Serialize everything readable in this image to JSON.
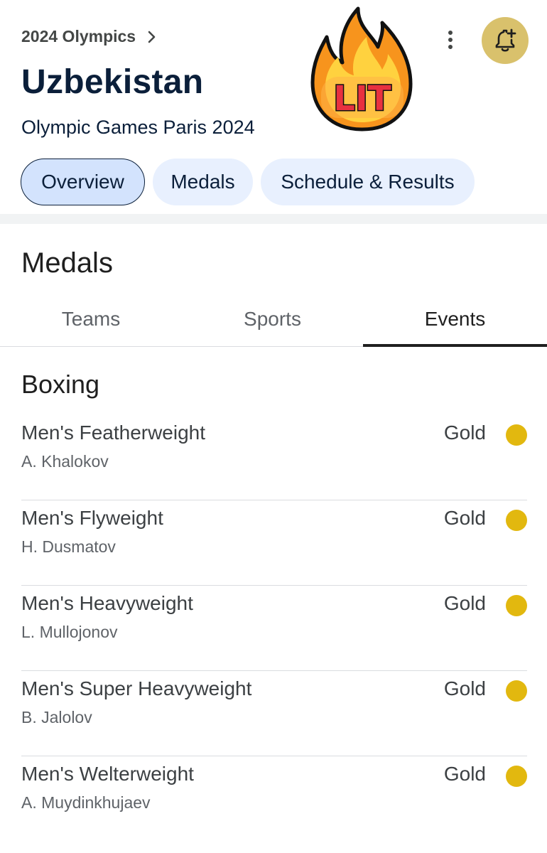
{
  "header": {
    "breadcrumb": "2024 Olympics",
    "title": "Uzbekistan",
    "subtitle": "Olympic Games Paris 2024",
    "sticker_text": "LIT"
  },
  "icons": {
    "breadcrumb": "chevron-right-icon",
    "menu": "more-vert-icon",
    "notify": "bell-plus-icon",
    "sticker": "fire-icon"
  },
  "chips": [
    {
      "label": "Overview",
      "selected": true
    },
    {
      "label": "Medals",
      "selected": false
    },
    {
      "label": "Schedule & Results",
      "selected": false
    }
  ],
  "medals": {
    "title": "Medals",
    "tabs": [
      {
        "label": "Teams",
        "selected": false
      },
      {
        "label": "Sports",
        "selected": false
      },
      {
        "label": "Events",
        "selected": true
      }
    ],
    "sport": "Boxing",
    "events": [
      {
        "name": "Men's Featherweight",
        "athlete": "A. Khalokov",
        "medal": "Gold"
      },
      {
        "name": "Men's Flyweight",
        "athlete": "H. Dusmatov",
        "medal": "Gold"
      },
      {
        "name": "Men's Heavyweight",
        "athlete": "L. Mullojonov",
        "medal": "Gold"
      },
      {
        "name": "Men's Super Heavyweight",
        "athlete": "B. Jalolov",
        "medal": "Gold"
      },
      {
        "name": "Men's Welterweight",
        "athlete": "A. Muydinkhujaev",
        "medal": "Gold"
      }
    ]
  },
  "colors": {
    "gold_medal": "#e2b80f",
    "bell_button": "#d9c16c",
    "title_text": "#0b1f3a",
    "chip_bg": "#e8f0fe",
    "chip_selected_bg": "#d3e3fd"
  }
}
